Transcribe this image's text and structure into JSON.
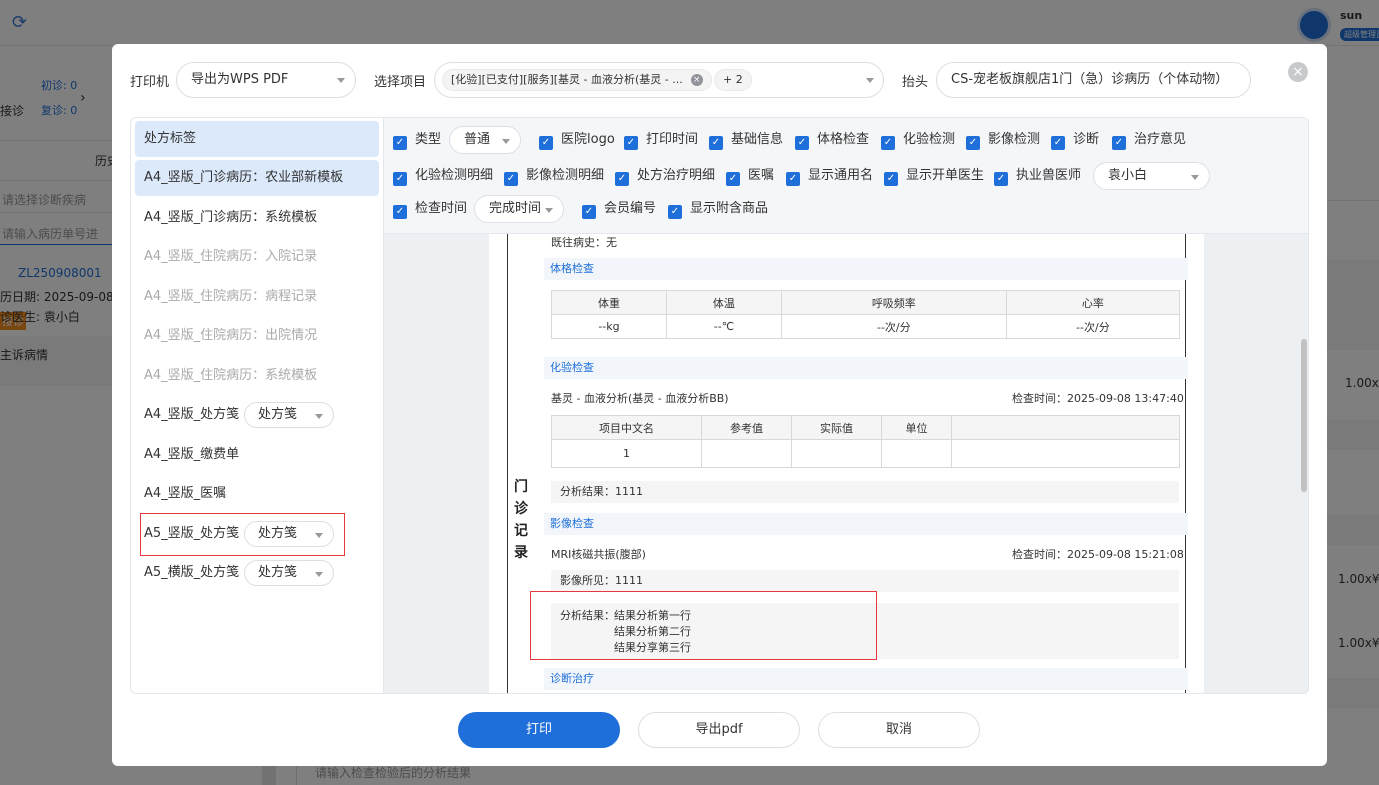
{
  "background": {
    "user_name": "sun",
    "user_role": "超级管理员",
    "first_visit": "初诊: 0",
    "return_visit": "复诊: 0",
    "reception": "接诊",
    "history_tab": "历史",
    "diagnosis_placeholder": "请选择诊断疾病",
    "record_search_placeholder": "请输入病历单号进",
    "visit_badge": "接诊",
    "record_no": "ZL250908001",
    "record_date": "历日期: 2025-09-08",
    "doctor": "诊医生: 袁小白",
    "chief_complaint": "主诉病情",
    "qty_1": "1.00x",
    "qty_2": "1.00x¥",
    "qty_3": "1.00x¥",
    "analysis_placeholder": "请输入检查检验后的分析结果"
  },
  "dialog": {
    "printer_label": "打印机",
    "printer_value": "导出为WPS PDF",
    "items_label": "选择项目",
    "items_tag": "[化验][已支付][服务][基灵 - 血液分析(基灵 - ...",
    "items_more": "+ 2",
    "heading_label": "抬头",
    "heading_value": "CS-宠老板旗舰店1门（急）诊病历（个体动物）",
    "close": "×"
  },
  "templates": [
    {
      "label": "处方标签"
    },
    {
      "label": "A4_竖版_门诊病历：农业部新模板"
    },
    {
      "label": "A4_竖版_门诊病历：系统模板"
    },
    {
      "label": "A4_竖版_住院病历：入院记录"
    },
    {
      "label": "A4_竖版_住院病历：病程记录"
    },
    {
      "label": "A4_竖版_住院病历：出院情况"
    },
    {
      "label": "A4_竖版_住院病历：系统模板"
    },
    {
      "label": "A4_竖版_处方笺",
      "select": "处方笺"
    },
    {
      "label": "A4_竖版_缴费单"
    },
    {
      "label": "A4_竖版_医嘱"
    },
    {
      "label": "A5_竖版_处方笺",
      "select": "处方笺"
    },
    {
      "label": "A5_横版_处方笺",
      "select": "处方笺"
    }
  ],
  "options": {
    "type_label": "类型",
    "type_value": "普通",
    "hospital_logo": "医院logo",
    "print_time": "打印时间",
    "basic_info": "基础信息",
    "physical_exam": "体格检查",
    "lab_test": "化验检测",
    "imaging": "影像检测",
    "diagnosis": "诊断",
    "treatment": "治疗意见",
    "lab_detail": "化验检测明细",
    "imaging_detail": "影像检测明细",
    "rx_detail": "处方治疗明细",
    "orders": "医嘱",
    "generic_name": "显示通用名",
    "prescriber": "显示开单医生",
    "vet_label": "执业兽医师",
    "vet_value": "袁小白",
    "check_time_label": "检查时间",
    "check_time_value": "完成时间",
    "member_no": "会员编号",
    "attached_goods": "显示附含商品"
  },
  "preview": {
    "past_history": "既往病史：无",
    "side_title": [
      "门",
      "诊",
      "记",
      "录"
    ],
    "physical_section": "体格检查",
    "physical_headers": [
      "体重",
      "体温",
      "呼吸频率",
      "心率"
    ],
    "physical_values": [
      "--kg",
      "--℃",
      "--次/分",
      "--次/分"
    ],
    "lab_section": "化验检查",
    "lab_item": "基灵 - 血液分析(基灵 - 血液分析BB)",
    "lab_time": "检查时间：2025-09-08 13:47:40",
    "lab_headers": [
      "项目中文名",
      "参考值",
      "实际值",
      "单位"
    ],
    "lab_row": [
      "1",
      "",
      "",
      ""
    ],
    "lab_result": "分析结果：1111",
    "imaging_section": "影像检查",
    "imaging_item": "MRI核磁共振(腹部)",
    "imaging_time": "检查时间：2025-09-08 15:21:08",
    "imaging_finding": "影像所见：1111",
    "analysis_label": "分析结果：",
    "analysis_lines": [
      "结果分析第一行",
      "结果分析第二行",
      "结果分享第三行"
    ],
    "diagnosis_section": "诊断治疗"
  },
  "buttons": {
    "print": "打印",
    "export_pdf": "导出pdf",
    "cancel": "取消"
  },
  "colors": {
    "primary": "#1e6fd9",
    "highlight": "#e4393c",
    "active_item": "#dbe9fb"
  }
}
